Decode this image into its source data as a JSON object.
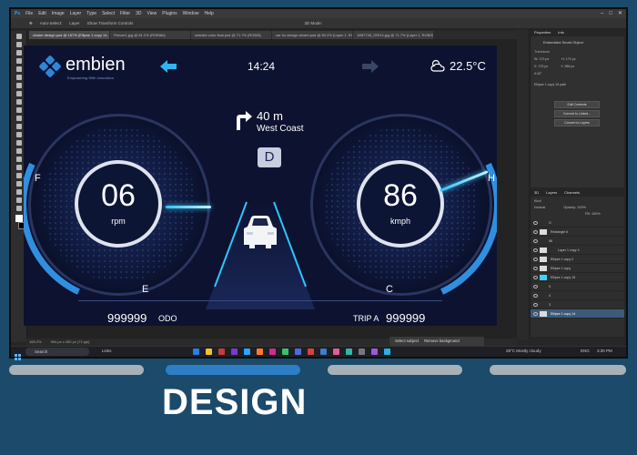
{
  "app": {
    "menu": [
      "Ps",
      "File",
      "Edit",
      "Image",
      "Layer",
      "Type",
      "Select",
      "Filter",
      "3D",
      "View",
      "Plugins",
      "Window",
      "Help"
    ],
    "options": [
      "Auto-Select:",
      "Layer",
      "Show Transform Controls",
      "3D Mode:"
    ],
    "tabs": [
      "cluster design.psd @ 167% (Ellipse 1 copy 14, RGB/8#)",
      "Picture1.jpg @ 81.2% (RGB/8#)",
      "website color final.psd @ 71.7% (RGB/8)",
      "car ho design cluster.psd @ 60.2% (Layer 1, RGB/8)",
      "16B7745_ORG4.jpg @ 71.7% (Layer 1, RGB/8)"
    ],
    "zoom": "165.2%",
    "status_info": "994 px x 400 px (72 ppi)"
  },
  "dashboard": {
    "brand": "embien",
    "brand_tagline": "Empowering With Innovation",
    "time": "14:24",
    "temperature": "22.5°C",
    "nav_distance": "40 m",
    "nav_street": "West Coast",
    "gear": "D",
    "left_gauge": {
      "value": "06",
      "unit": "rpm",
      "left_label": "F",
      "bottom_label": "E"
    },
    "right_gauge": {
      "value": "86",
      "unit": "kmph",
      "right_label": "H",
      "bottom_label": "C"
    },
    "odo_value": "999999",
    "odo_label": "ODO",
    "trip_label": "TRIP A",
    "trip_value": "999999",
    "colors": {
      "accent": "#2fc4ff",
      "background": "#0d1230",
      "gauge_ring": "#dfe3ee"
    }
  },
  "properties": {
    "title": "Properties",
    "tab2": "Info",
    "object": "Embedded Smart Object",
    "section_transform": "Transform",
    "w": "W: 170 px",
    "h": "H: 170 px",
    "x": "X: 175 px",
    "y": "Y: 386 px",
    "angle": "0.00°",
    "layer_name": "Ellipse 1 copy 15 path",
    "btn_edit": "Edit Contents",
    "btn_linked": "Convert to Linked...",
    "btn_layers": "Convert to Layers"
  },
  "layers": {
    "tab1": "3D",
    "tab2": "Layers",
    "tab3": "Channels",
    "kind": "Kind",
    "mode": "Normal",
    "opacity": "Opacity: 100%",
    "fill": "Fill: 100%",
    "items": [
      "G",
      "Rectangle 6",
      "96",
      "Layer 1 copy 4",
      "Ellipse 1 copy 2",
      "Ellipse 1 copy",
      "Ellipse 1 copy 15",
      "5",
      "4",
      "3",
      "Ellipse 1 copy 14"
    ]
  },
  "taskbar": {
    "search": "Search",
    "links": "Links",
    "select_subject": "Select subject",
    "remove_bg": "Remove background",
    "weather": "28°C Mostly cloudy",
    "lang": "ENG",
    "clock": "3:30 PM"
  },
  "footer": {
    "title": "DESIGN",
    "pills": [
      {
        "active": false
      },
      {
        "active": true
      },
      {
        "active": false
      },
      {
        "active": false
      }
    ]
  }
}
